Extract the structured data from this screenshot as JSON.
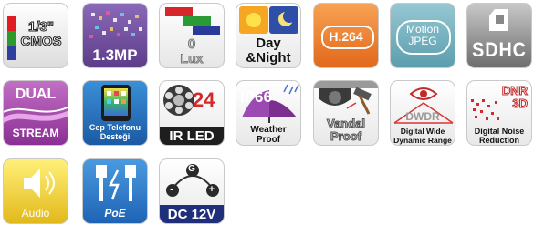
{
  "features": {
    "cmos": {
      "label": "1/3\"\nCMOS",
      "colors": [
        "#e01b24",
        "#2b9a2b",
        "#2f3f9f"
      ]
    },
    "mp": {
      "label": "1.3MP"
    },
    "lux": {
      "value": "0",
      "unit": "Lux",
      "colors": [
        "#d6262b",
        "#2a9a37",
        "#2a3a9a"
      ]
    },
    "daynight": {
      "label": "Day\n&Night"
    },
    "h264": {
      "label": "H.264"
    },
    "motion": {
      "label": "Motion\nJPEG"
    },
    "sdhc": {
      "label": "SDHC"
    },
    "dual": {
      "top": "DUAL",
      "bottom": "STREAM"
    },
    "phone": {
      "label": "Cep Telefonu\nDesteği"
    },
    "irled": {
      "number": "24",
      "label": "IR LED"
    },
    "weather": {
      "code": "IP66",
      "label": "Weather\nProof"
    },
    "vandal": {
      "label": "Vandal\nProof"
    },
    "dwdr": {
      "code": "DWDR",
      "label": "Digital Wide\nDynamic Range"
    },
    "dnr": {
      "code": "DNR\n3D",
      "label": "Digital Noise\nReduction"
    },
    "audio": {
      "label": "Audio"
    },
    "poe": {
      "label": "PoE"
    },
    "dc": {
      "label": "DC 12V",
      "symbols": [
        "G",
        "-",
        "+"
      ]
    }
  }
}
